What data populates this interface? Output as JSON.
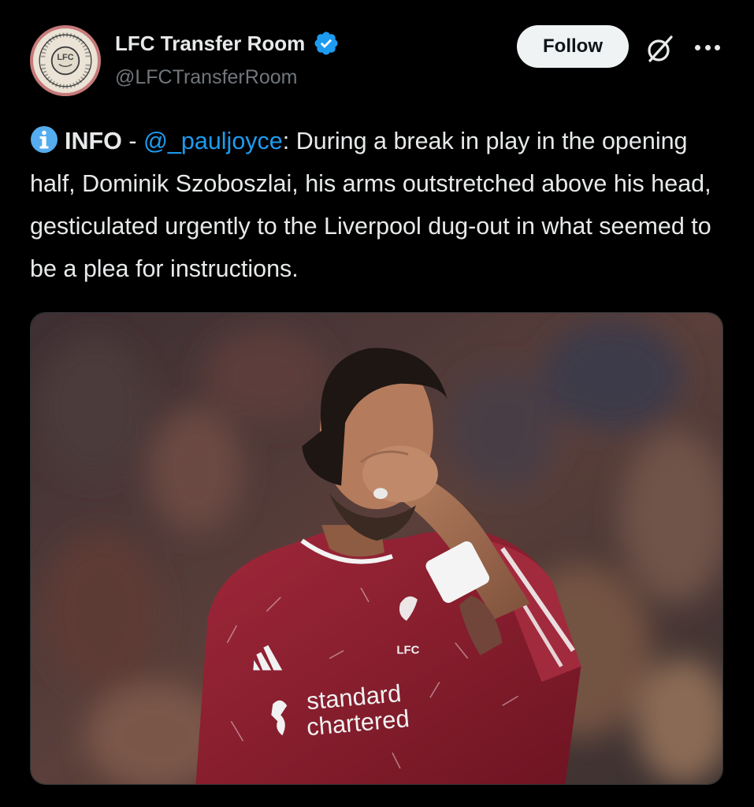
{
  "tweet": {
    "author": {
      "display_name": "LFC Transfer Room",
      "handle": "@LFCTransferRoom",
      "verified": true,
      "avatar_logo_text": "TRANSFER ROOM · LFC"
    },
    "follow_label": "Follow",
    "info_label": "INFO",
    "separator": " - ",
    "mention": "@_pauljoyce",
    "body": ": During a break in play in the opening half, Dominik Szoboszlai, his arms outstretched above his head, gesticulated urgently to the Liverpool dug-out in what seemed to be a plea for instructions.",
    "media": {
      "shirt_sponsor_line1": "standard",
      "shirt_sponsor_line2": "chartered",
      "shirt_crest_text": "LFC"
    }
  },
  "colors": {
    "background": "#000000",
    "text": "#e7e9ea",
    "secondary_text": "#71767b",
    "link": "#1d9bf0",
    "verified_badge": "#1d9bf0",
    "follow_button_bg": "#eff3f4",
    "jersey": "#8a1c2b"
  },
  "icons": {
    "verified": "verified-badge-icon",
    "grok": "grok-icon",
    "more": "more-icon",
    "info": "info-icon"
  }
}
